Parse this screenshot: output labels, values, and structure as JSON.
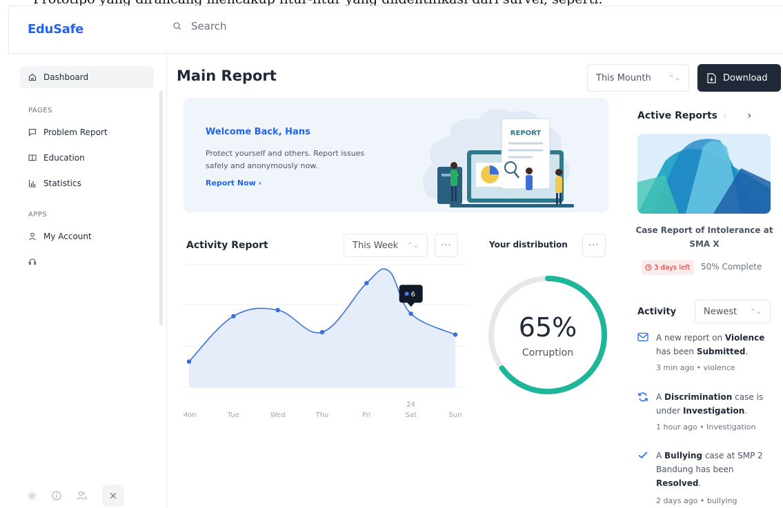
{
  "caption": "Prototipo yang dirancang mencakup fitur-fitur yang diidentifikasi dari survei, seperti:",
  "app": {
    "logo": "EduSafe",
    "search_placeholder": "Search"
  },
  "sidebar": {
    "dashboard": "Dashboard",
    "pages_heading": "PAGES",
    "problem_report": "Problem Report",
    "education": "Education",
    "statistics": "Statistics",
    "apps_heading": "APPS",
    "my_account": "My Account"
  },
  "header": {
    "title": "Main Report",
    "period": "This Mounth",
    "download": "Download"
  },
  "banner": {
    "greeting": "Welcome Back, Hans",
    "text": "Protect yourself and others. Report issues safely and anonymously now.",
    "cta": "Report Now",
    "illustration_label": "REPORT"
  },
  "activity_report": {
    "title": "Activity Report",
    "range": "This Week",
    "more": "···"
  },
  "chart_data": {
    "type": "line",
    "categories": [
      "Mon",
      "Tue",
      "Wed",
      "Thu",
      "Fri",
      "Sat",
      "Sun"
    ],
    "x_sublabels": [
      "",
      "",
      "",
      "",
      "",
      "24",
      ""
    ],
    "values": [
      2.1,
      5.8,
      6.3,
      4.5,
      8.5,
      6.0,
      4.3
    ],
    "peak": {
      "value": 9.5,
      "between": [
        "Fri",
        "Sat"
      ]
    },
    "ylim": [
      0,
      10
    ],
    "tooltip": {
      "category": "Sat",
      "label": "6"
    },
    "line_color": "#3b6fd6",
    "fill_color": "#dbe6f8",
    "grid": true
  },
  "distribution": {
    "title": "Your distribution",
    "more": "···",
    "percent": "65%",
    "fraction": 0.65,
    "label": "Corruption",
    "accent": "#1fb59a"
  },
  "active_reports": {
    "title": "Active Reports",
    "prev": "‹",
    "next": "›",
    "case_title": "Case Report of Intolerance at SMA X",
    "deadline": "3 days left",
    "progress": "50% Complete"
  },
  "activity": {
    "title": "Activity",
    "sort": "Newest",
    "items": [
      {
        "pre": "A new report on ",
        "b1": "Violence",
        "mid": " has been ",
        "b2": "Submitted",
        "post": ".",
        "meta": "3 min ago • violence"
      },
      {
        "pre": "A ",
        "b1": "Discrimination",
        "mid": " case is under ",
        "b2": "Investigation",
        "post": ".",
        "meta": "1 hour ago • Investigation"
      },
      {
        "pre": "A ",
        "b1": "Bullying",
        "mid": " case at SMP 2 Bandung has been ",
        "b2": "Resolved",
        "post": ".",
        "meta": "2 days ago • bullying"
      }
    ]
  },
  "colors": {
    "brand": "#2563eb",
    "dark_button": "#1f2937",
    "danger": "#dc2626"
  }
}
